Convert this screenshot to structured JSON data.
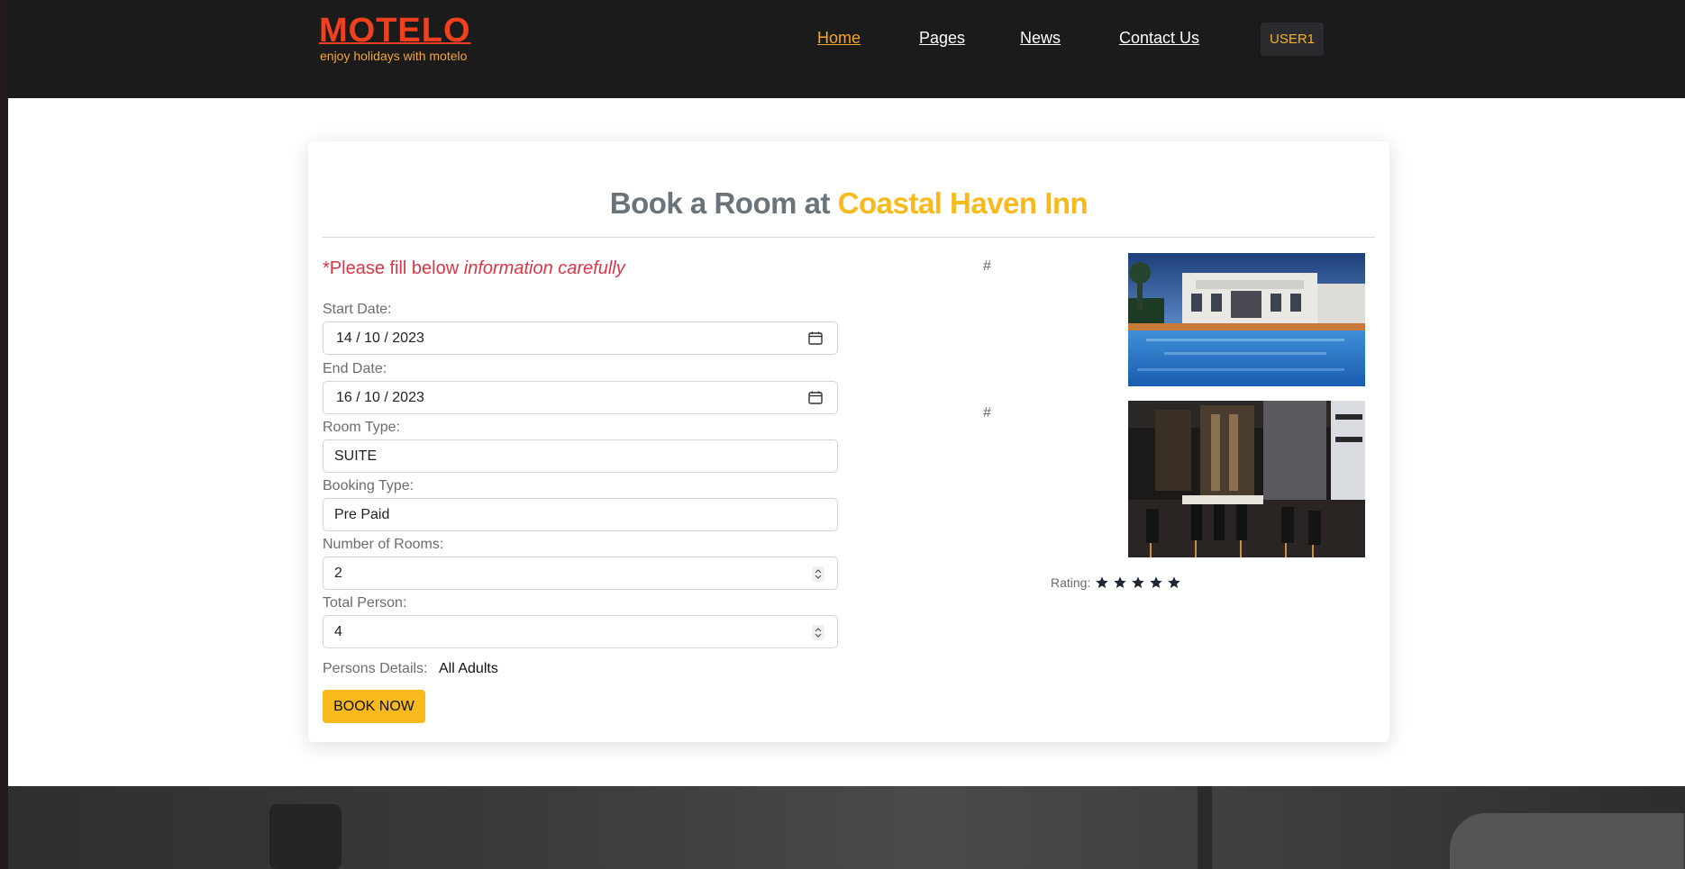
{
  "header": {
    "logo_title": "MOTELO",
    "logo_tagline": "enjoy holidays with motelo",
    "nav": [
      {
        "label": "Home",
        "active": true
      },
      {
        "label": "Pages",
        "active": false
      },
      {
        "label": "News",
        "active": false
      },
      {
        "label": "Contact Us",
        "active": false
      }
    ],
    "user_label": "USER1"
  },
  "booking": {
    "title_prefix": "Book a Room at",
    "hotel_name": "Coastal Haven Inn",
    "notice_prefix": "*Please fill below",
    "notice_emph": "information carefully",
    "fields": {
      "start_date": {
        "label": "Start Date:",
        "value": "14 / 10 / 2023"
      },
      "end_date": {
        "label": "End Date:",
        "value": "16 / 10 / 2023"
      },
      "room_type": {
        "label": "Room Type:",
        "value": "SUITE"
      },
      "booking_type": {
        "label": "Booking Type:",
        "value": "Pre Paid"
      },
      "num_rooms": {
        "label": "Number of Rooms:",
        "value": "2"
      },
      "total_person": {
        "label": "Total Person:",
        "value": "4"
      }
    },
    "persons_details_label": "Persons Details:",
    "persons_details_value": "All Adults",
    "book_button": "BOOK NOW"
  },
  "gallery": {
    "items": [
      {
        "hash": "#",
        "image": "hotel-pool-photo"
      },
      {
        "hash": "#",
        "image": "restaurant-interior-photo"
      }
    ],
    "rating_label": "Rating:",
    "rating_value": 5,
    "rating_max": 5
  },
  "colors": {
    "accent": "#f7b91c",
    "logo": "#f0401e",
    "notice": "#dc3545",
    "header_bg": "#1b1b1b",
    "nav_active": "#f5a623"
  }
}
